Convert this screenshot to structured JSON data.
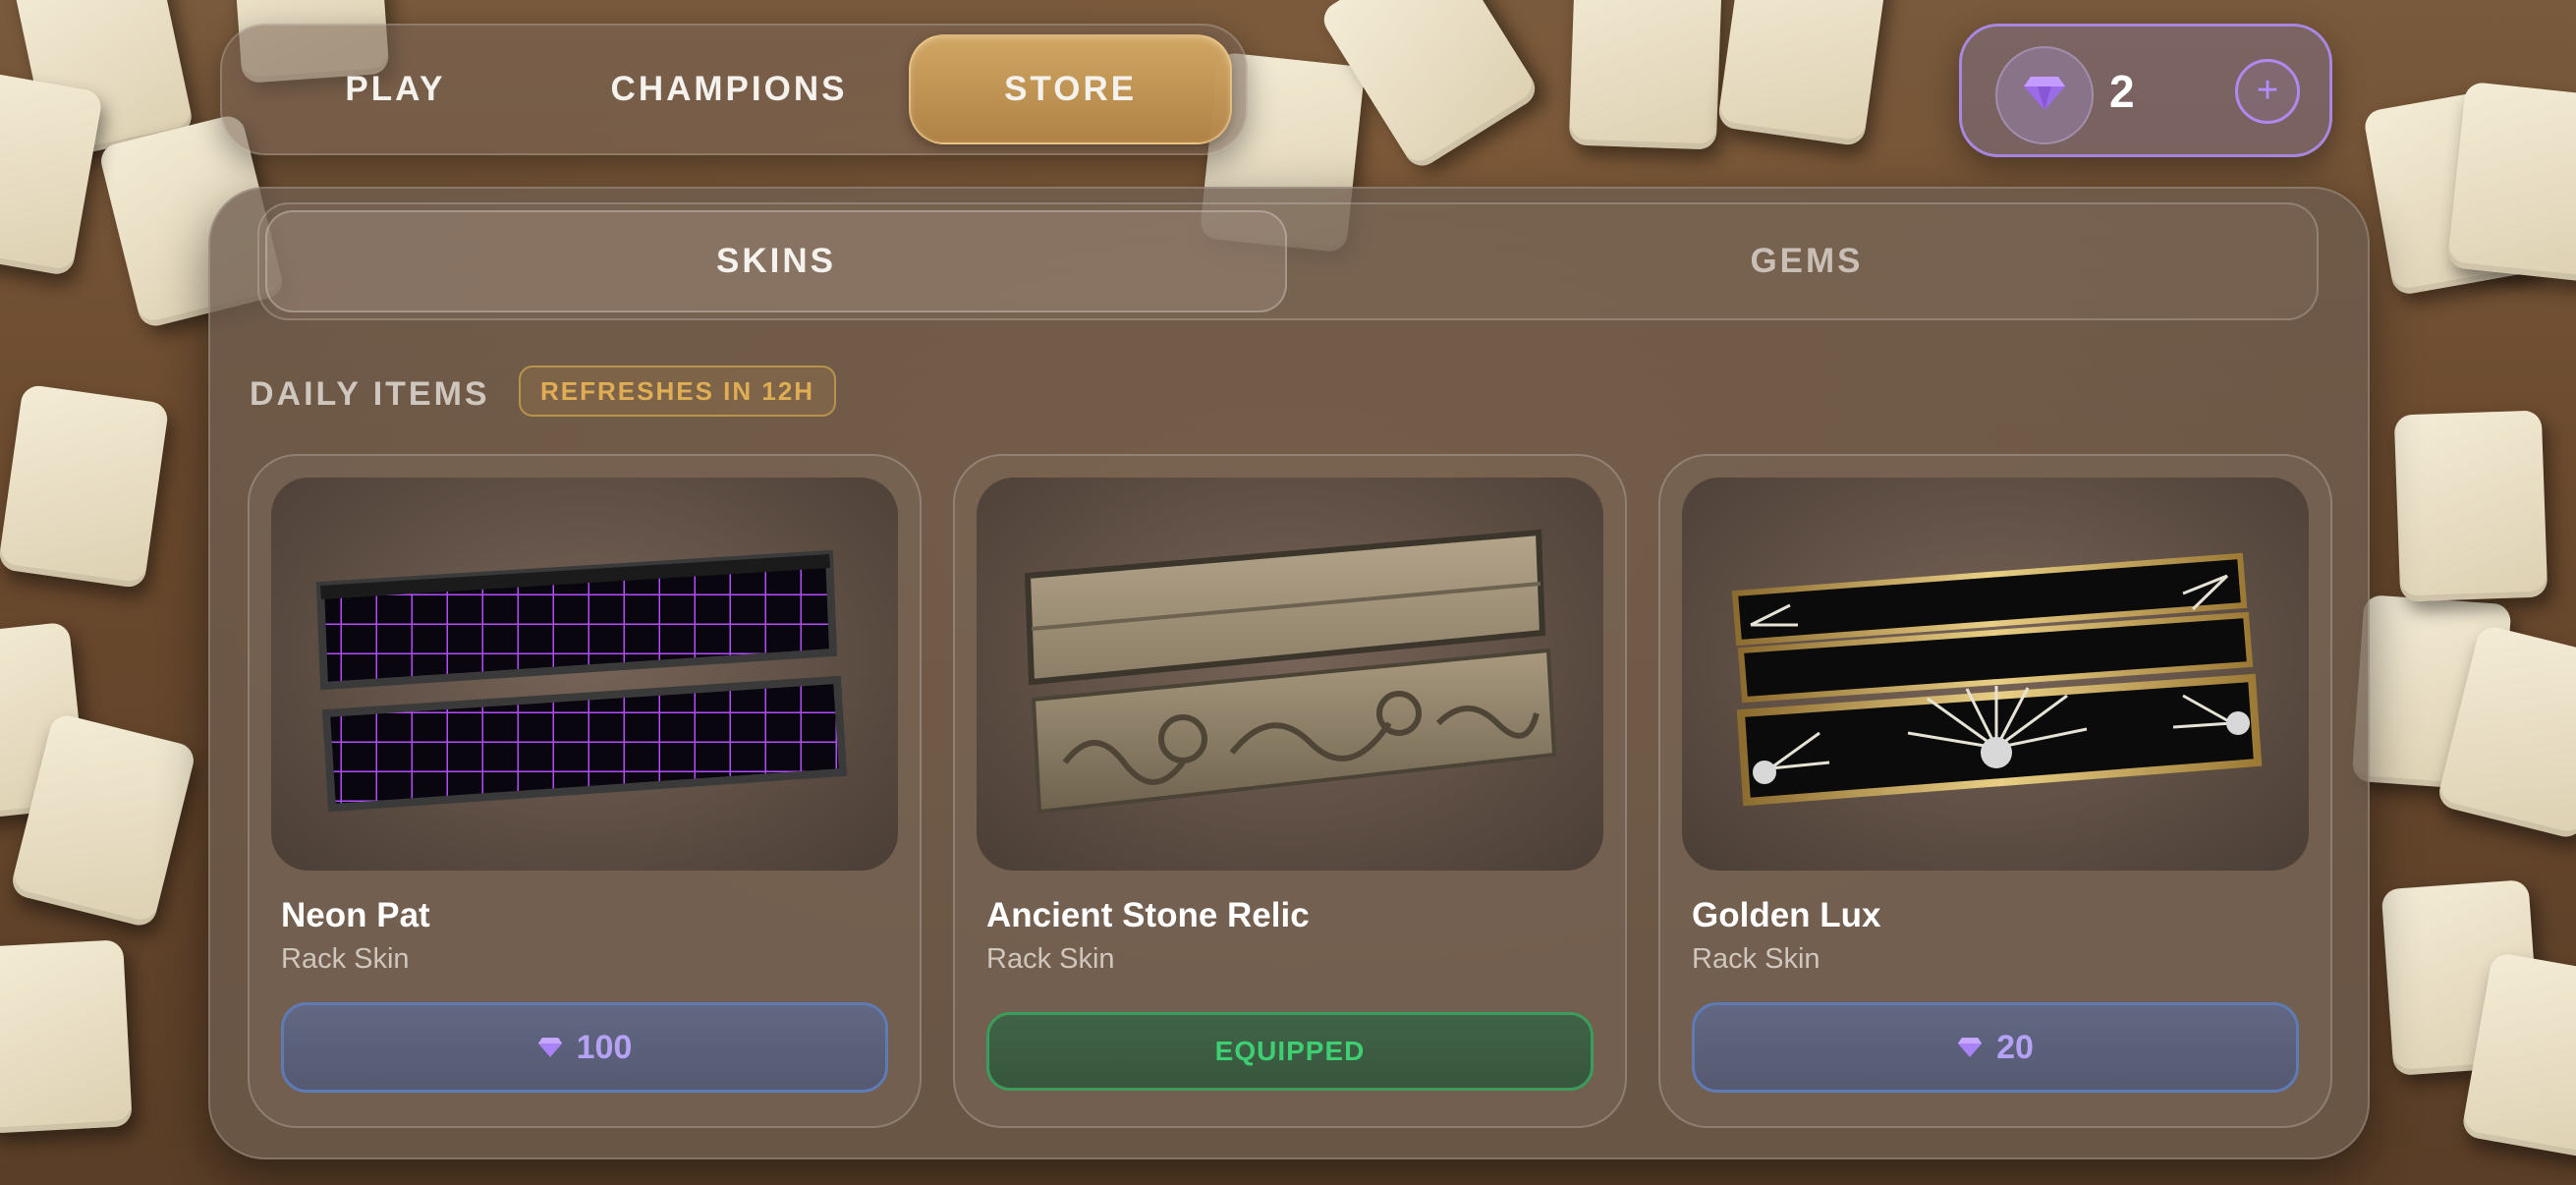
{
  "nav": {
    "tabs": [
      {
        "label": "PLAY"
      },
      {
        "label": "CHAMPIONS"
      },
      {
        "label": "STORE"
      }
    ],
    "active": "STORE"
  },
  "wallet": {
    "gem_count": "2",
    "gem_icon": "gem-icon",
    "add_label": "+"
  },
  "store": {
    "subtabs": [
      {
        "label": "SKINS"
      },
      {
        "label": "GEMS"
      }
    ],
    "active_subtab": "SKINS",
    "section_title": "DAILY ITEMS",
    "refresh_badge": "REFRESHES IN 12H",
    "items": [
      {
        "name": "Neon Pat",
        "type": "Rack Skin",
        "price": "100",
        "state": "buy"
      },
      {
        "name": "Ancient Stone Relic",
        "type": "Rack Skin",
        "status": "EQUIPPED",
        "state": "equipped"
      },
      {
        "name": "Golden Lux",
        "type": "Rack Skin",
        "price": "20",
        "state": "buy"
      }
    ]
  },
  "colors": {
    "accent_store": "#c99a5a",
    "gem_purple": "#b48cff",
    "price_border": "#5f7bb6",
    "equipped_green": "#3fcf73",
    "badge_gold": "#e0ad55"
  }
}
